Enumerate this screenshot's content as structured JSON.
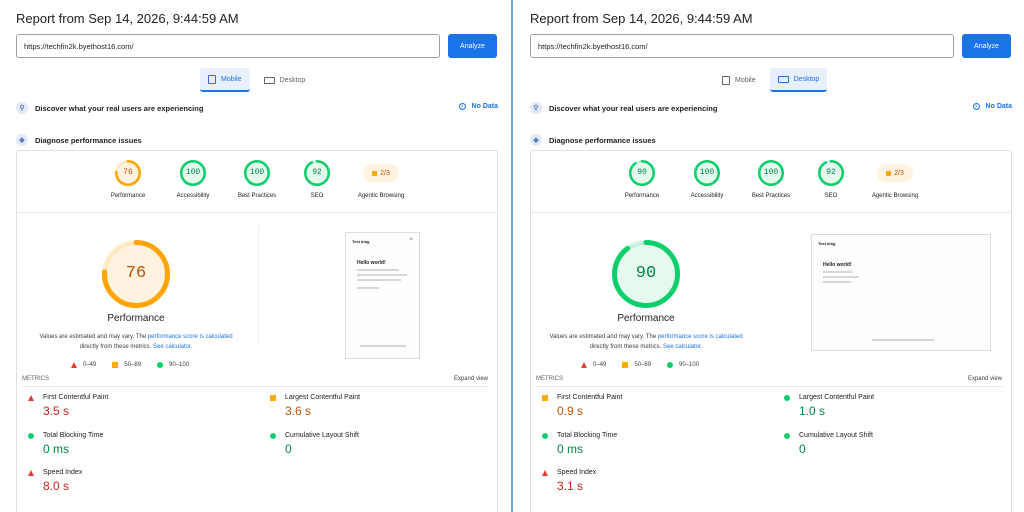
{
  "left": {
    "title": "Report from Sep 14, 2026, 9:44:59 AM",
    "url": "https://techfin2k.byethost16.com/",
    "analyze_label": "Analyze",
    "tabs": [
      {
        "label": "Mobile",
        "active": true
      },
      {
        "label": "Desktop",
        "active": false
      }
    ],
    "discover": "Discover what your real users are experiencing",
    "no_data": "No Data",
    "diagnose": "Diagnose performance issues",
    "gauges": [
      {
        "label": "Performance",
        "value": "76",
        "color": "#ffa400"
      },
      {
        "label": "Accessibility",
        "value": "100",
        "color": "#0cce6b"
      },
      {
        "label": "Best Practices",
        "value": "100",
        "color": "#0cce6b"
      },
      {
        "label": "SEO",
        "value": "92",
        "color": "#0cce6b"
      }
    ],
    "agentic": {
      "label": "Agentic Browsing",
      "value": "2/3"
    },
    "big_score": {
      "value": "76",
      "label": "Performance",
      "color": "#ffa400"
    },
    "note": {
      "text1": "Values are estimated and may vary. The ",
      "link1": "performance score is calculated",
      "text2": "directly from these metrics. ",
      "link2": "See calculator."
    },
    "legend": [
      "0–49",
      "50–89",
      "90–100"
    ],
    "metrics_label": "METRICS",
    "expand_label": "Expand view",
    "screenshot": {
      "site_title": "Test blog",
      "post_title": "Hello world!"
    },
    "metrics": [
      {
        "label": "First Contentful Paint",
        "value": "3.5 s",
        "status": "red"
      },
      {
        "label": "Largest Contentful Paint",
        "value": "3.6 s",
        "status": "orange"
      },
      {
        "label": "Total Blocking Time",
        "value": "0 ms",
        "status": "green"
      },
      {
        "label": "Cumulative Layout Shift",
        "value": "0",
        "status": "green"
      },
      {
        "label": "Speed Index",
        "value": "8.0 s",
        "status": "red"
      }
    ]
  },
  "right": {
    "title": "Report from Sep 14, 2026, 9:44:59 AM",
    "url": "https://techfin2k.byethost16.com/",
    "analyze_label": "Analyze",
    "tabs": [
      {
        "label": "Mobile",
        "active": false
      },
      {
        "label": "Desktop",
        "active": true
      }
    ],
    "discover": "Discover what your real users are experiencing",
    "no_data": "No Data",
    "diagnose": "Diagnose performance issues",
    "gauges": [
      {
        "label": "Performance",
        "value": "90",
        "color": "#0cce6b"
      },
      {
        "label": "Accessibility",
        "value": "100",
        "color": "#0cce6b"
      },
      {
        "label": "Best Practices",
        "value": "100",
        "color": "#0cce6b"
      },
      {
        "label": "SEO",
        "value": "92",
        "color": "#0cce6b"
      }
    ],
    "agentic": {
      "label": "Agentic Browsing",
      "value": "2/3"
    },
    "big_score": {
      "value": "90",
      "label": "Performance",
      "color": "#0cce6b"
    },
    "note": {
      "text1": "Values are estimated and may vary. The ",
      "link1": "performance score is calculated",
      "text2": "directly from these metrics. ",
      "link2": "See calculator."
    },
    "legend": [
      "0–49",
      "50–89",
      "90–100"
    ],
    "metrics_label": "METRICS",
    "expand_label": "Expand view",
    "screenshot": {
      "site_title": "Test blog",
      "post_title": "Hello world!"
    },
    "metrics": [
      {
        "label": "First Contentful Paint",
        "value": "0.9 s",
        "status": "orange"
      },
      {
        "label": "Largest Contentful Paint",
        "value": "1.0 s",
        "status": "green"
      },
      {
        "label": "Total Blocking Time",
        "value": "0 ms",
        "status": "green"
      },
      {
        "label": "Cumulative Layout Shift",
        "value": "0",
        "status": "green"
      },
      {
        "label": "Speed Index",
        "value": "3.1 s",
        "status": "red"
      }
    ]
  }
}
